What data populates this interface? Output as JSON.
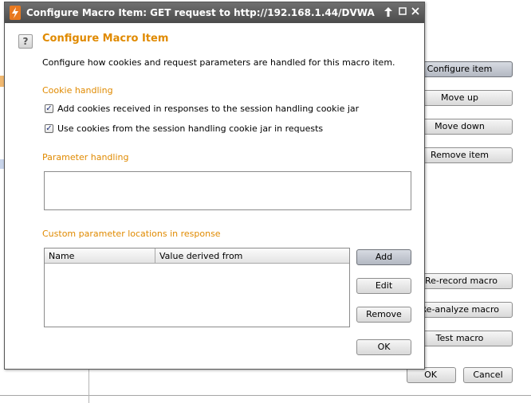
{
  "dialog": {
    "title": "Configure Macro Item: GET request to http://192.168.1.44/DVWA",
    "heading": "Configure Macro Item",
    "description": "Configure how cookies and request parameters are handled for this macro item.",
    "cookie_handling": {
      "label": "Cookie handling",
      "options": [
        {
          "label": "Add cookies received in responses to the session handling cookie jar",
          "checked": true
        },
        {
          "label": "Use cookies from the session handling cookie jar in requests",
          "checked": true
        }
      ]
    },
    "parameter_handling": {
      "label": "Parameter handling"
    },
    "custom_locations": {
      "label": "Custom parameter locations in response",
      "columns": [
        "Name",
        "Value derived from"
      ],
      "rows": []
    },
    "buttons": {
      "add": "Add",
      "edit": "Edit",
      "remove": "Remove",
      "ok": "OK"
    }
  },
  "background": {
    "buttons": {
      "configure_item": "Configure item",
      "move_up": "Move up",
      "move_down": "Move down",
      "remove_item": "Remove item",
      "rerecord": "Re-record macro",
      "reanalyze": "Re-analyze macro",
      "test": "Test macro",
      "ok": "OK",
      "cancel": "Cancel"
    }
  }
}
